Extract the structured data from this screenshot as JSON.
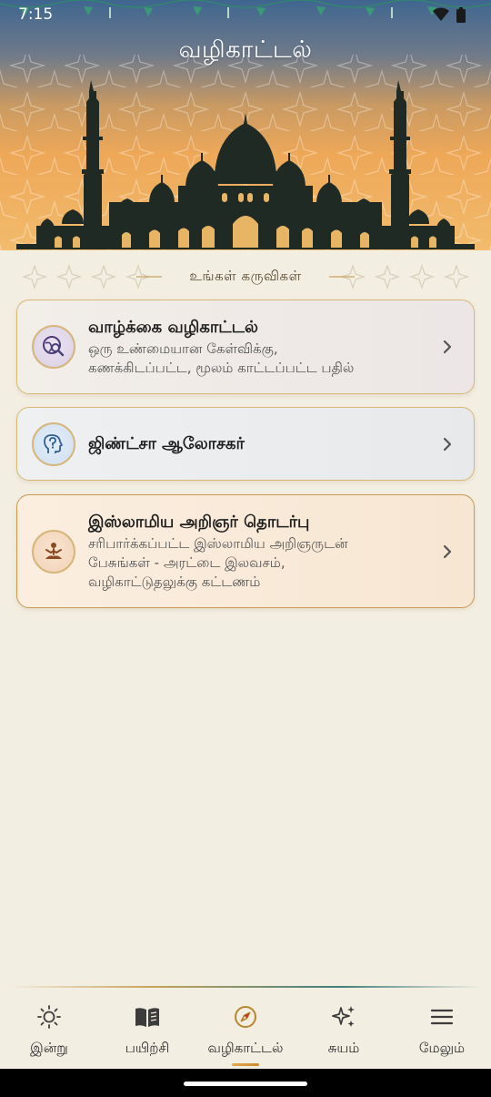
{
  "status_bar": {
    "time": "7:15",
    "icons": [
      "wifi-icon",
      "battery-icon"
    ]
  },
  "header": {
    "title": "வழிகாட்டல்"
  },
  "section": {
    "label": "உங்கள் கருவிகள்"
  },
  "cards": [
    {
      "title": "வாழ்க்கை வழிகாட்டல்",
      "subtitle_lines": [
        "ஒரு உண்மையான கேள்விக்கு,",
        "கணக்கிடப்பட்ட, மூலம் காட்டப்பட்ட பதில்"
      ],
      "icon": "search-globe-icon",
      "icon_color": "#4a3f7a"
    },
    {
      "title": "ஜிண்ட்சா ஆலோசகர்",
      "subtitle_lines": [],
      "icon": "head-question-icon",
      "icon_color": "#2e5f94"
    },
    {
      "title": "இஸ்லாமிய அறிஞர் தொடர்பு",
      "subtitle_lines": [
        "சரிபார்க்கப்பட்ட இஸ்லாமிய அறிஞருடன்",
        "பேசுங்கள் - அரட்டை இலவசம்,",
        "வழிகாட்டுதலுக்கு கட்டணம்"
      ],
      "icon": "meditating-person-icon",
      "icon_color": "#8a4a22"
    }
  ],
  "bottom_nav": {
    "items": [
      {
        "label": "இன்று",
        "icon": "sun-icon"
      },
      {
        "label": "பயிற்சி",
        "icon": "book-icon"
      },
      {
        "label": "வழிகாட்டல்",
        "icon": "compass-icon",
        "active": true
      },
      {
        "label": "சுயம்",
        "icon": "sparkles-icon"
      },
      {
        "label": "மேலும்",
        "icon": "menu-icon"
      }
    ]
  },
  "colors": {
    "background": "#f3eee2",
    "accent_gold": "#d9b877",
    "header_top": "#3f6690",
    "header_bottom": "#f2bb6d",
    "mosque_silhouette": "#1f2a25"
  }
}
